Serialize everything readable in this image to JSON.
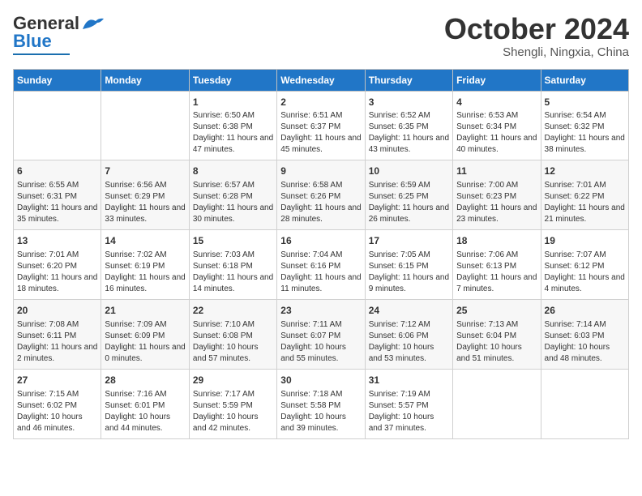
{
  "header": {
    "logo_general": "General",
    "logo_blue": "Blue",
    "month": "October 2024",
    "location": "Shengli, Ningxia, China"
  },
  "days_of_week": [
    "Sunday",
    "Monday",
    "Tuesday",
    "Wednesday",
    "Thursday",
    "Friday",
    "Saturday"
  ],
  "weeks": [
    [
      {
        "day": "",
        "info": ""
      },
      {
        "day": "",
        "info": ""
      },
      {
        "day": "1",
        "info": "Sunrise: 6:50 AM\nSunset: 6:38 PM\nDaylight: 11 hours and 47 minutes."
      },
      {
        "day": "2",
        "info": "Sunrise: 6:51 AM\nSunset: 6:37 PM\nDaylight: 11 hours and 45 minutes."
      },
      {
        "day": "3",
        "info": "Sunrise: 6:52 AM\nSunset: 6:35 PM\nDaylight: 11 hours and 43 minutes."
      },
      {
        "day": "4",
        "info": "Sunrise: 6:53 AM\nSunset: 6:34 PM\nDaylight: 11 hours and 40 minutes."
      },
      {
        "day": "5",
        "info": "Sunrise: 6:54 AM\nSunset: 6:32 PM\nDaylight: 11 hours and 38 minutes."
      }
    ],
    [
      {
        "day": "6",
        "info": "Sunrise: 6:55 AM\nSunset: 6:31 PM\nDaylight: 11 hours and 35 minutes."
      },
      {
        "day": "7",
        "info": "Sunrise: 6:56 AM\nSunset: 6:29 PM\nDaylight: 11 hours and 33 minutes."
      },
      {
        "day": "8",
        "info": "Sunrise: 6:57 AM\nSunset: 6:28 PM\nDaylight: 11 hours and 30 minutes."
      },
      {
        "day": "9",
        "info": "Sunrise: 6:58 AM\nSunset: 6:26 PM\nDaylight: 11 hours and 28 minutes."
      },
      {
        "day": "10",
        "info": "Sunrise: 6:59 AM\nSunset: 6:25 PM\nDaylight: 11 hours and 26 minutes."
      },
      {
        "day": "11",
        "info": "Sunrise: 7:00 AM\nSunset: 6:23 PM\nDaylight: 11 hours and 23 minutes."
      },
      {
        "day": "12",
        "info": "Sunrise: 7:01 AM\nSunset: 6:22 PM\nDaylight: 11 hours and 21 minutes."
      }
    ],
    [
      {
        "day": "13",
        "info": "Sunrise: 7:01 AM\nSunset: 6:20 PM\nDaylight: 11 hours and 18 minutes."
      },
      {
        "day": "14",
        "info": "Sunrise: 7:02 AM\nSunset: 6:19 PM\nDaylight: 11 hours and 16 minutes."
      },
      {
        "day": "15",
        "info": "Sunrise: 7:03 AM\nSunset: 6:18 PM\nDaylight: 11 hours and 14 minutes."
      },
      {
        "day": "16",
        "info": "Sunrise: 7:04 AM\nSunset: 6:16 PM\nDaylight: 11 hours and 11 minutes."
      },
      {
        "day": "17",
        "info": "Sunrise: 7:05 AM\nSunset: 6:15 PM\nDaylight: 11 hours and 9 minutes."
      },
      {
        "day": "18",
        "info": "Sunrise: 7:06 AM\nSunset: 6:13 PM\nDaylight: 11 hours and 7 minutes."
      },
      {
        "day": "19",
        "info": "Sunrise: 7:07 AM\nSunset: 6:12 PM\nDaylight: 11 hours and 4 minutes."
      }
    ],
    [
      {
        "day": "20",
        "info": "Sunrise: 7:08 AM\nSunset: 6:11 PM\nDaylight: 11 hours and 2 minutes."
      },
      {
        "day": "21",
        "info": "Sunrise: 7:09 AM\nSunset: 6:09 PM\nDaylight: 11 hours and 0 minutes."
      },
      {
        "day": "22",
        "info": "Sunrise: 7:10 AM\nSunset: 6:08 PM\nDaylight: 10 hours and 57 minutes."
      },
      {
        "day": "23",
        "info": "Sunrise: 7:11 AM\nSunset: 6:07 PM\nDaylight: 10 hours and 55 minutes."
      },
      {
        "day": "24",
        "info": "Sunrise: 7:12 AM\nSunset: 6:06 PM\nDaylight: 10 hours and 53 minutes."
      },
      {
        "day": "25",
        "info": "Sunrise: 7:13 AM\nSunset: 6:04 PM\nDaylight: 10 hours and 51 minutes."
      },
      {
        "day": "26",
        "info": "Sunrise: 7:14 AM\nSunset: 6:03 PM\nDaylight: 10 hours and 48 minutes."
      }
    ],
    [
      {
        "day": "27",
        "info": "Sunrise: 7:15 AM\nSunset: 6:02 PM\nDaylight: 10 hours and 46 minutes."
      },
      {
        "day": "28",
        "info": "Sunrise: 7:16 AM\nSunset: 6:01 PM\nDaylight: 10 hours and 44 minutes."
      },
      {
        "day": "29",
        "info": "Sunrise: 7:17 AM\nSunset: 5:59 PM\nDaylight: 10 hours and 42 minutes."
      },
      {
        "day": "30",
        "info": "Sunrise: 7:18 AM\nSunset: 5:58 PM\nDaylight: 10 hours and 39 minutes."
      },
      {
        "day": "31",
        "info": "Sunrise: 7:19 AM\nSunset: 5:57 PM\nDaylight: 10 hours and 37 minutes."
      },
      {
        "day": "",
        "info": ""
      },
      {
        "day": "",
        "info": ""
      }
    ]
  ]
}
